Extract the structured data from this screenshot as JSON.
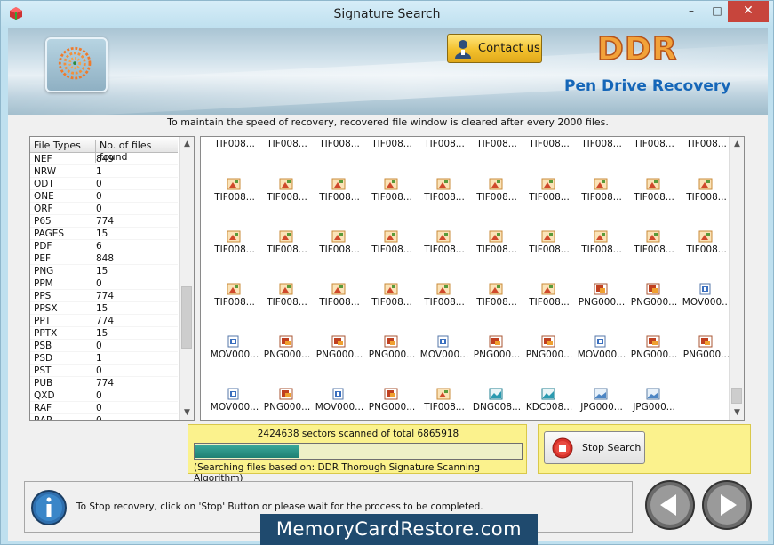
{
  "window": {
    "title": "Signature Search",
    "controls": {
      "minimize": "–",
      "maximize": "□",
      "close": "✕"
    }
  },
  "header": {
    "contact_label": "Contact us",
    "brand": "DDR",
    "brand_sub": "Pen Drive Recovery"
  },
  "notice": "To maintain the speed of recovery, recovered file window is cleared after every 2000 files.",
  "file_types": {
    "headers": [
      "File Types",
      "No. of files found"
    ],
    "rows": [
      [
        "NEF",
        "849"
      ],
      [
        "NRW",
        "1"
      ],
      [
        "ODT",
        "0"
      ],
      [
        "ONE",
        "0"
      ],
      [
        "ORF",
        "0"
      ],
      [
        "P65",
        "774"
      ],
      [
        "PAGES",
        "15"
      ],
      [
        "PDF",
        "6"
      ],
      [
        "PEF",
        "848"
      ],
      [
        "PNG",
        "15"
      ],
      [
        "PPM",
        "0"
      ],
      [
        "PPS",
        "774"
      ],
      [
        "PPSX",
        "15"
      ],
      [
        "PPT",
        "774"
      ],
      [
        "PPTX",
        "15"
      ],
      [
        "PSB",
        "0"
      ],
      [
        "PSD",
        "1"
      ],
      [
        "PST",
        "0"
      ],
      [
        "PUB",
        "774"
      ],
      [
        "QXD",
        "0"
      ],
      [
        "RAF",
        "0"
      ],
      [
        "RAR",
        "0"
      ]
    ]
  },
  "thumbnails": {
    "rows": [
      [
        "TIF008...",
        "TIF008...",
        "TIF008...",
        "TIF008...",
        "TIF008...",
        "TIF008...",
        "TIF008...",
        "TIF008...",
        "TIF008...",
        "TIF008..."
      ],
      [
        "TIF008...",
        "TIF008...",
        "TIF008...",
        "TIF008...",
        "TIF008...",
        "TIF008...",
        "TIF008...",
        "TIF008...",
        "TIF008...",
        "TIF008..."
      ],
      [
        "TIF008...",
        "TIF008...",
        "TIF008...",
        "TIF008...",
        "TIF008...",
        "TIF008...",
        "TIF008...",
        "TIF008...",
        "TIF008...",
        "TIF008..."
      ],
      [
        "TIF008...",
        "TIF008...",
        "TIF008...",
        "TIF008...",
        "TIF008...",
        "TIF008...",
        "TIF008...",
        "PNG000...",
        "PNG000...",
        "MOV000..."
      ],
      [
        "MOV000...",
        "PNG000...",
        "PNG000...",
        "PNG000...",
        "MOV000...",
        "PNG000...",
        "PNG000...",
        "MOV000...",
        "PNG000...",
        "PNG000..."
      ],
      [
        "MOV000...",
        "PNG000...",
        "MOV000...",
        "PNG000...",
        "TIF008...",
        "DNG008...",
        "KDC008...",
        "JPG000...",
        "JPG000..."
      ]
    ],
    "icon_types": {
      "TIF": "tif-file-icon",
      "PNG": "png-file-icon",
      "MOV": "mov-file-icon",
      "DNG": "image-file-icon",
      "KDC": "image-file-icon",
      "JPG": "jpg-file-icon"
    }
  },
  "progress": {
    "text": "2424638 sectors scanned of total 6865918",
    "fraction": 0.32,
    "algorithm": "(Searching files based on:  DDR Thorough Signature Scanning Algorithm)"
  },
  "stop_label": "Stop Search",
  "bottom": {
    "hint": "To Stop recovery, click on 'Stop' Button or please wait for the process to be completed."
  },
  "watermark": "MemoryCardRestore.com",
  "colors": {
    "accent_yellow": "#fbf28d",
    "progress_fill": "#1e8073",
    "brand_orange": "#f2a23a",
    "brand_blue": "#1566b8",
    "close_red": "#c7453c"
  }
}
